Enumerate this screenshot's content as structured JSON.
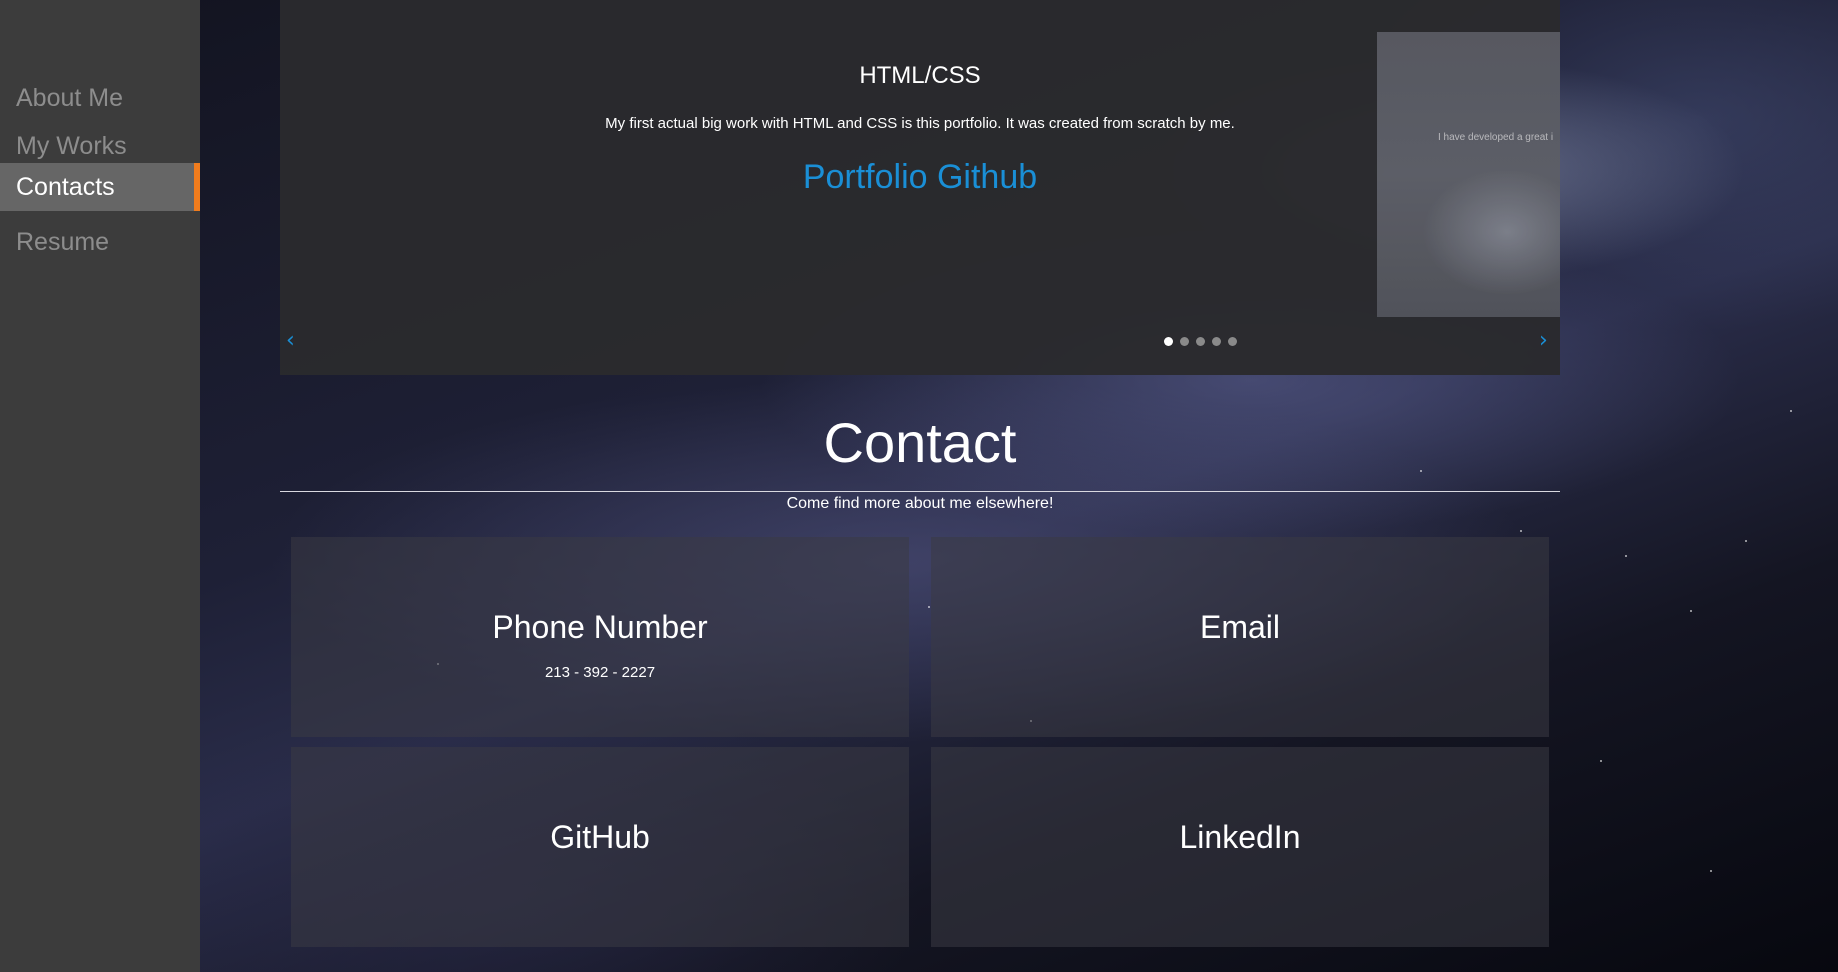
{
  "sidebar": {
    "items": [
      {
        "label": "About Me",
        "active": false
      },
      {
        "label": "My Works",
        "active": false
      },
      {
        "label": "Contacts",
        "active": true
      },
      {
        "label": "Resume",
        "active": false
      }
    ],
    "accent_color": "#f07c1d"
  },
  "carousel": {
    "slide_title": "HTML/CSS",
    "slide_description": "My first actual big work with HTML and CSS is this portfolio. It was created from scratch by me.",
    "slide_link": "Portfolio Github",
    "next_slide_preview_text": "I have developed a great i",
    "prev_arrow_icon": "chevron-left-icon",
    "next_arrow_icon": "chevron-right-icon",
    "dot_count": 5,
    "active_dot": 1,
    "link_color": "#1a8fd6"
  },
  "contact": {
    "title": "Contact",
    "subtitle": "Come find more about me elsewhere!",
    "cards": [
      {
        "title": "Phone Number",
        "detail": "213 - 392 - 2227"
      },
      {
        "title": "Email",
        "detail": ""
      },
      {
        "title": "GitHub",
        "detail": ""
      },
      {
        "title": "LinkedIn",
        "detail": ""
      }
    ]
  }
}
